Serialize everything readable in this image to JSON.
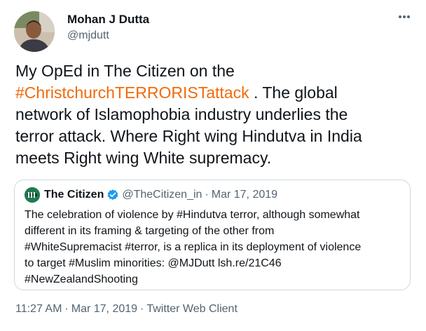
{
  "author": {
    "name": "Mohan J Dutta",
    "handle": "@mjdutt"
  },
  "tweet": {
    "line1": "My OpEd in The Citizen on the",
    "hashtag": "#ChristchurchTERRORISTattack",
    "after_hashtag": " . The global",
    "line3": "network of Islamophobia industry underlies the",
    "line4": "terror attack. Where Right wing Hindutva in India",
    "line5": "meets Right wing White supremacy."
  },
  "quote": {
    "name": "The Citizen",
    "handle": "@TheCitizen_in",
    "separator": "·",
    "date": "Mar 17, 2019",
    "lines": [
      "The celebration of violence by #Hindutva terror, although somewhat",
      "different in its framing & targeting of the other from",
      "#WhiteSupremacist #terror, is a replica in its deployment of violence",
      "to target #Muslim minorities: @MJDutt lsh.re/21C46",
      "#NewZealandShooting"
    ]
  },
  "meta": {
    "time": "11:27 AM",
    "date": "Mar 17, 2019",
    "client": "Twitter Web Client",
    "separator": "·"
  },
  "icons": {
    "more": "more-icon",
    "verified": "verified-badge-icon",
    "logo": "citizen-logo-icon"
  },
  "colors": {
    "hashtag": "#f06a0a",
    "verified": "#1d9bf0",
    "secondary_text": "#536471",
    "border": "#cfd9de"
  }
}
